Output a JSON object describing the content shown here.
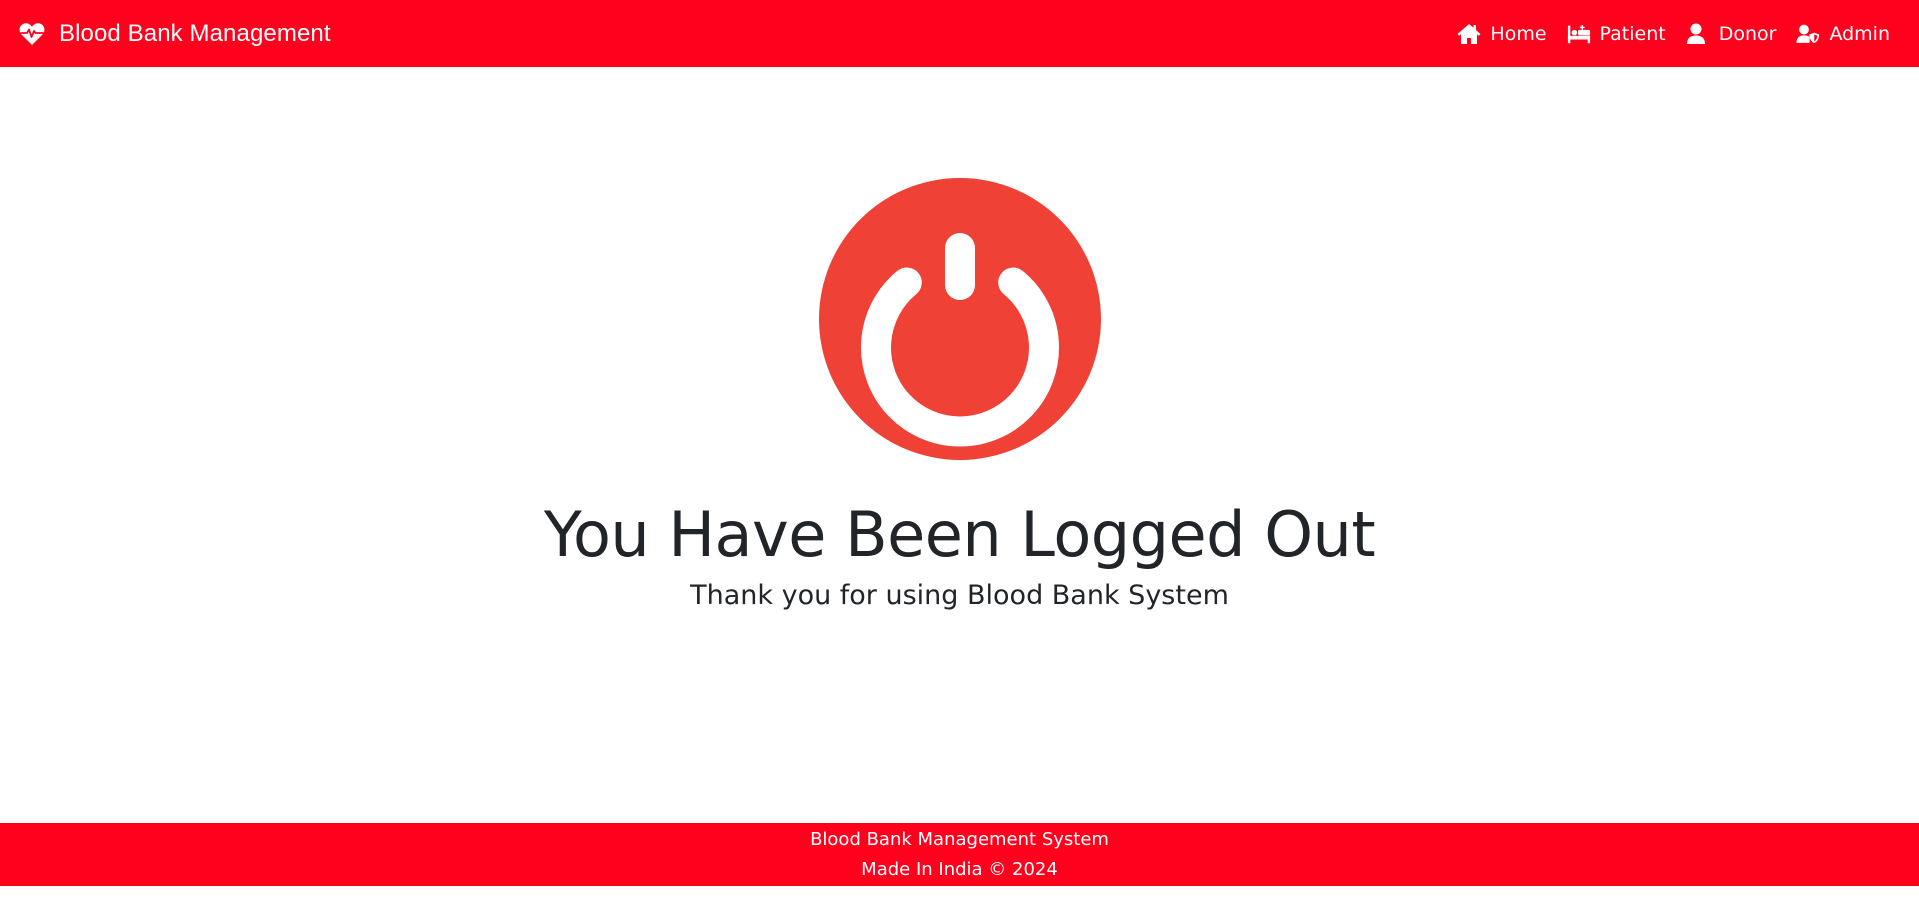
{
  "navbar": {
    "brand_icon": "heart-pulse-icon",
    "brand": "Blood Bank Management",
    "background": "#ff001d",
    "items": [
      {
        "label": "Home",
        "icon": "home-icon"
      },
      {
        "label": "Patient",
        "icon": "patient-bed-icon"
      },
      {
        "label": "Donor",
        "icon": "user-icon"
      },
      {
        "label": "Admin",
        "icon": "user-shield-icon"
      }
    ]
  },
  "main": {
    "icon": "power-icon",
    "icon_color": "#ef4136",
    "title": "You Have Been Logged Out",
    "subtitle": "Thank you for using Blood Bank System"
  },
  "footer": {
    "line1": "Blood Bank Management System",
    "line2": "Made In India © 2024"
  }
}
